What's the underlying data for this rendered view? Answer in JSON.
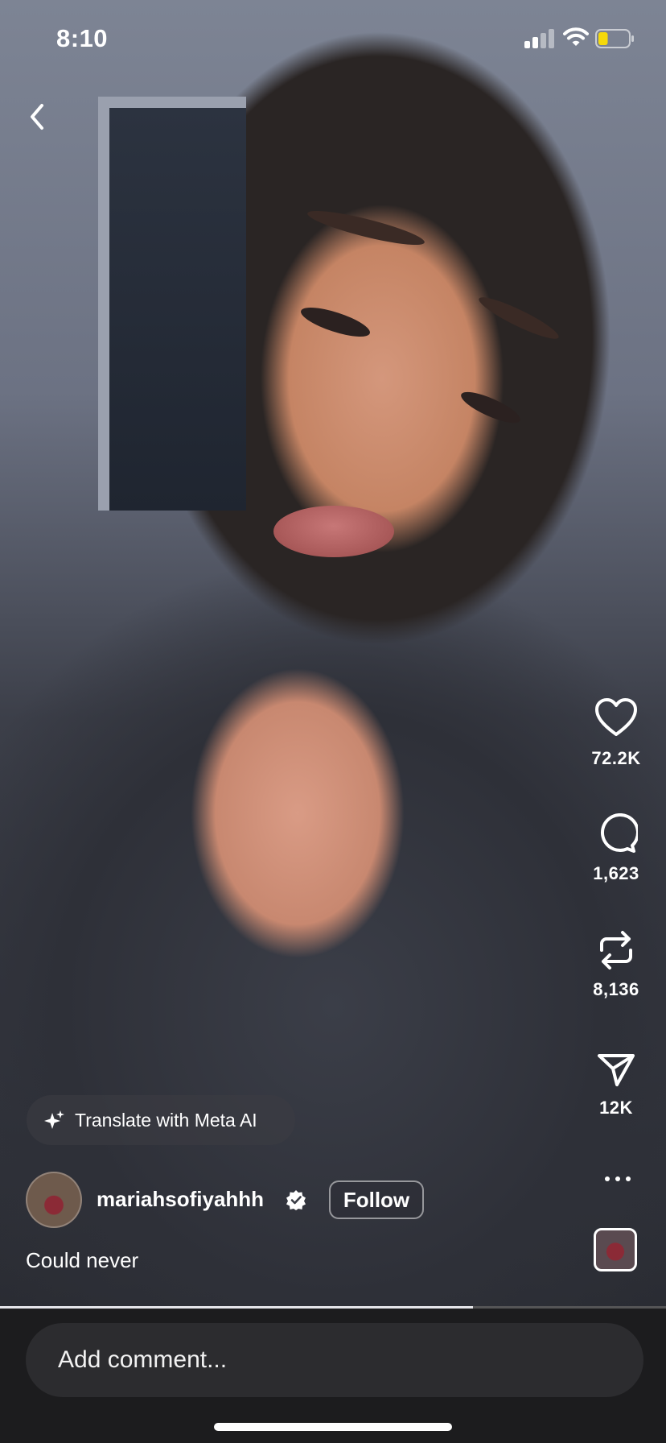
{
  "status_bar": {
    "time": "8:10",
    "signal_bars_active": 2,
    "battery_level": 0.2,
    "battery_color": "#f5d90a"
  },
  "post": {
    "translate_label": "Translate with Meta AI",
    "username": "mariahsofiyahhh",
    "follow_label": "Follow",
    "caption": "Could never",
    "playback_progress": 0.71
  },
  "actions": {
    "likes": "72.2K",
    "comments": "1,623",
    "reposts": "8,136",
    "shares": "12K"
  },
  "icons": [
    "back-chevron-icon",
    "heart-icon",
    "comment-bubble-icon",
    "repost-icon",
    "send-icon",
    "more-icon",
    "sparkle-icon",
    "verified-badge-icon"
  ],
  "comment_bar": {
    "placeholder": "Add comment..."
  }
}
